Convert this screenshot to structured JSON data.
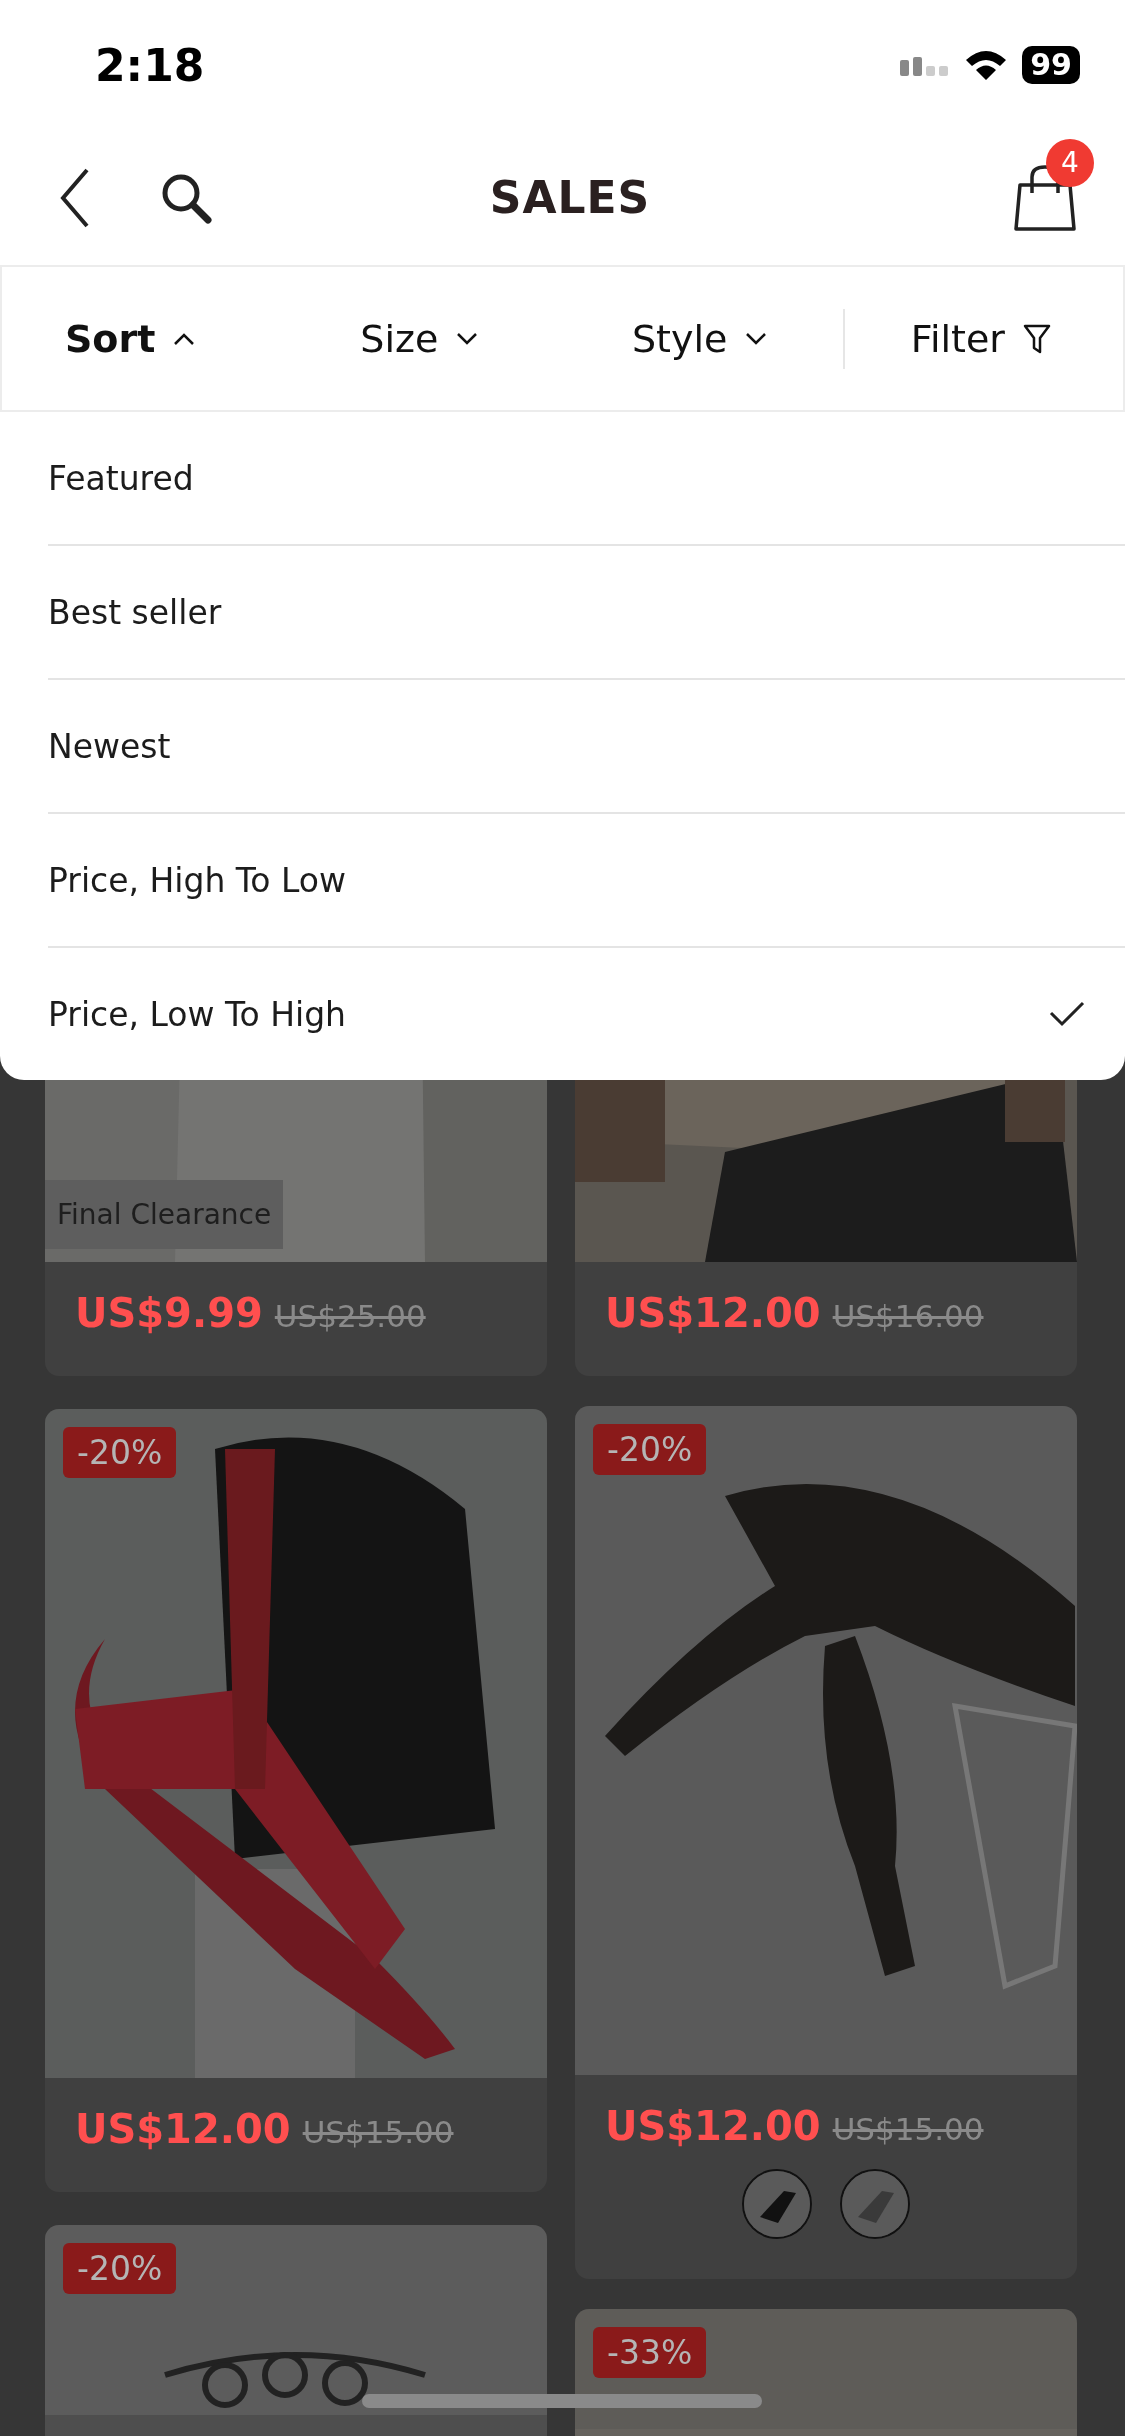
{
  "status_bar": {
    "time": "2:18",
    "battery": "99"
  },
  "nav": {
    "title": "SALES",
    "cart_count": "4"
  },
  "filters": [
    {
      "kind": "menu",
      "label": "Sort",
      "expanded": true
    },
    {
      "kind": "menu",
      "label": "Size",
      "expanded": false
    },
    {
      "kind": "menu",
      "label": "Style",
      "expanded": false
    },
    {
      "kind": "filter",
      "label": "Filter"
    }
  ],
  "sort_options": [
    {
      "label": "Featured",
      "selected": false
    },
    {
      "label": "Best seller",
      "selected": false
    },
    {
      "label": "Newest",
      "selected": false
    },
    {
      "label": "Price, High To Low",
      "selected": false
    },
    {
      "label": "Price, Low To High",
      "selected": true
    }
  ],
  "columns": [
    [
      {
        "tag": "Final Clearance",
        "price": "US$9.99",
        "original_price": "US$25.00"
      },
      {
        "badge": "-20%",
        "price": "US$12.00",
        "original_price": "US$15.00"
      },
      {
        "badge": "-20%"
      }
    ],
    [
      {
        "price": "US$12.00",
        "original_price": "US$16.00"
      },
      {
        "badge": "-20%",
        "price": "US$12.00",
        "original_price": "US$15.00"
      },
      {
        "badge": "-33%"
      }
    ]
  ]
}
